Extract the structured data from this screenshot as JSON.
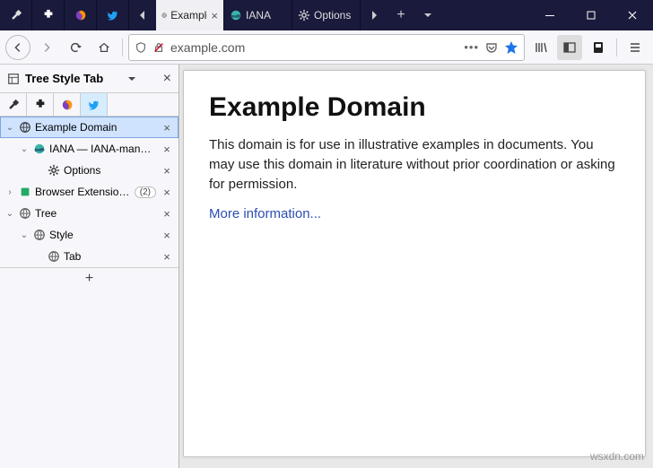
{
  "titlebar": {
    "tabs": [
      {
        "label": "Example Domain",
        "close": "×"
      },
      {
        "label": "IANA",
        "close": ""
      },
      {
        "label": "Options",
        "close": ""
      }
    ]
  },
  "toolbar": {
    "url": "example.com"
  },
  "sidebar": {
    "title": "Tree Style Tab",
    "close": "×",
    "tree": [
      {
        "label": "Example Domain",
        "twisty": "⌄",
        "indent": 0,
        "active": true,
        "icon": "globe"
      },
      {
        "label": "IANA — IANA-managed",
        "twisty": "⌄",
        "indent": 1,
        "active": false,
        "icon": "iana"
      },
      {
        "label": "Options",
        "twisty": "",
        "indent": 2,
        "active": false,
        "icon": "gear"
      },
      {
        "label": "Browser Extensions - ",
        "twisty": "›",
        "indent": 0,
        "active": false,
        "icon": "puzzle",
        "count": "(2)"
      },
      {
        "label": "Tree",
        "twisty": "⌄",
        "indent": 0,
        "active": false,
        "icon": "globe-out"
      },
      {
        "label": "Style",
        "twisty": "⌄",
        "indent": 1,
        "active": false,
        "icon": "globe-out"
      },
      {
        "label": "Tab",
        "twisty": "",
        "indent": 2,
        "active": false,
        "icon": "globe-out"
      }
    ],
    "newtab": "+"
  },
  "page": {
    "title": "Example Domain",
    "body": "This domain is for use in illustrative examples in documents. You may use this domain in literature without prior coordination or asking for permission.",
    "link": "More information..."
  },
  "watermark": "wsxdn.com"
}
